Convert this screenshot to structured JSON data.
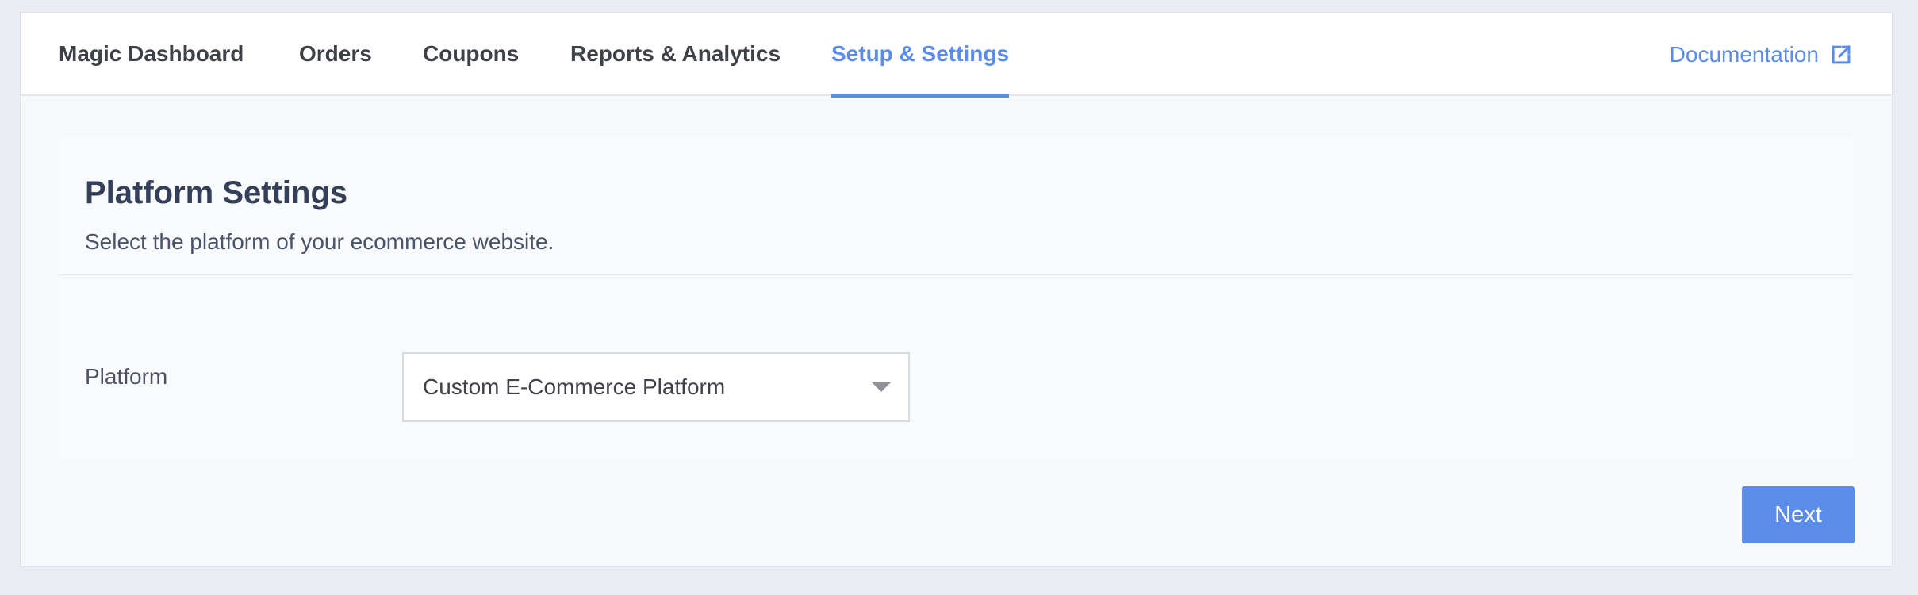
{
  "nav": {
    "tabs": [
      {
        "label": "Magic Dashboard",
        "active": false
      },
      {
        "label": "Orders",
        "active": false
      },
      {
        "label": "Coupons",
        "active": false
      },
      {
        "label": "Reports & Analytics",
        "active": false
      },
      {
        "label": "Setup & Settings",
        "active": true
      }
    ],
    "documentation_label": "Documentation",
    "documentation_icon": "external-link-icon"
  },
  "platform_settings": {
    "title": "Platform Settings",
    "subtitle": "Select the platform of your ecommerce website.",
    "platform_label": "Platform",
    "platform_value": "Custom E-Commerce Platform"
  },
  "actions": {
    "next_label": "Next"
  },
  "colors": {
    "accent": "#5b8cea",
    "text": "#3e4148",
    "heading": "#34405a",
    "background": "#e9edf3"
  }
}
